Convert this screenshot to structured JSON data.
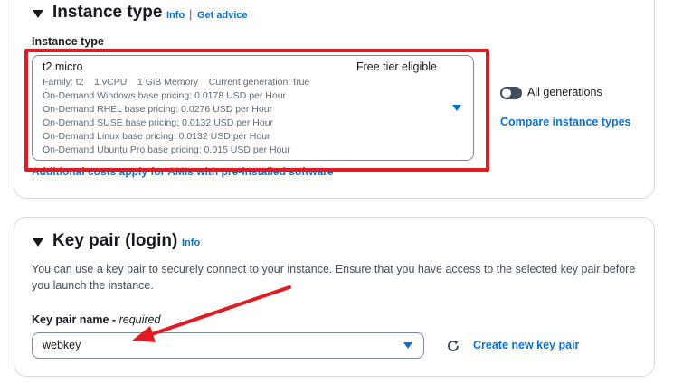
{
  "instance_type": {
    "title": "Instance type",
    "info": "Info",
    "separator": "|",
    "advice": "Get advice",
    "field_label": "Instance type",
    "selected": {
      "name": "t2.micro",
      "badge": "Free tier eligible",
      "details": [
        "Family: t2    1 vCPU    1 GiB Memory    Current generation: true",
        "On-Demand Windows base pricing: 0.0178 USD per Hour",
        "On-Demand RHEL base pricing: 0.0276 USD per Hour",
        "On-Demand SUSE base pricing: 0.0132 USD per Hour",
        "On-Demand Linux base pricing: 0.0132 USD per Hour",
        "On-Demand Ubuntu Pro base pricing: 0.015 USD per Hour"
      ]
    },
    "all_generations": "All generations",
    "compare": "Compare instance types",
    "additional_costs": "Additional costs apply for AMIs with pre-installed software"
  },
  "key_pair": {
    "title": "Key pair (login)",
    "info": "Info",
    "description": "You can use a key pair to securely connect to your instance. Ensure that you have access to the selected key pair before you launch the instance.",
    "field_label": "Key pair name - ",
    "required": "required",
    "value": "webkey",
    "create_new": "Create new key pair"
  },
  "colors": {
    "highlight": "#e11b22",
    "link": "#0972d3"
  }
}
